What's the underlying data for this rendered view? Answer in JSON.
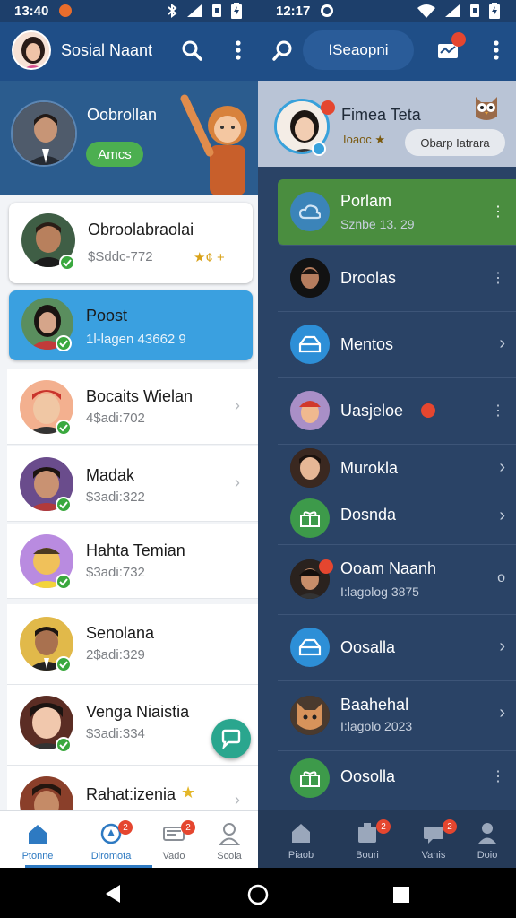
{
  "status_bar": {
    "left_time": "13:40",
    "right_time": "12:17"
  },
  "app_bar": {
    "title": "Sosial Naant",
    "search_pill": "ISeaopni"
  },
  "left_panel": {
    "profile": {
      "name": "Oobrollan",
      "chip": "Amcs"
    },
    "cards": [
      {
        "name": "Obroolabraolai",
        "sub": "$Sddc-772",
        "tag": "★¢ +"
      },
      {
        "name": "Poost",
        "sub": "1l-lagen 43662  9"
      }
    ],
    "rows": [
      {
        "name": "Bocaits Wielan",
        "sub": "4$adi:702"
      },
      {
        "name": "Madak",
        "sub": "$3adi:322"
      },
      {
        "name": "Hahta Temian",
        "sub": "$3adi:732"
      },
      {
        "name": "Senolana",
        "sub": "2$adi:329"
      },
      {
        "name": "Venga Niaistia",
        "sub": "$3adi:334"
      },
      {
        "name": "Rahat:izenia",
        "sub": ""
      }
    ]
  },
  "left_nav": [
    {
      "label": "Ptonne"
    },
    {
      "label": "Dlromota",
      "badge": "2"
    },
    {
      "label": "Vado",
      "badge": "2"
    },
    {
      "label": "Scola"
    }
  ],
  "right_panel": {
    "header": {
      "name": "Fimea Teta",
      "status": "Ioaoc ★",
      "pill": "Obarp Iatrara"
    },
    "items": [
      {
        "name": "Porlam",
        "sub": "Sznbe 13. 29",
        "trail": "⋮"
      },
      {
        "name": "Droolas",
        "sub": "",
        "trail": "⋮"
      },
      {
        "name": "Mentos",
        "sub": "",
        "trail": "›"
      },
      {
        "name": "Uasjeloe",
        "sub": "",
        "trail": "⋮"
      },
      {
        "name": "Murokla",
        "sub": "",
        "trail": "›"
      },
      {
        "name": "Dosnda",
        "sub": "",
        "trail": "›"
      },
      {
        "name": "Ooam Naanh",
        "sub": "I:lagolog 3875",
        "trail": "o"
      },
      {
        "name": "Oosalla",
        "sub": "",
        "trail": "›"
      },
      {
        "name": "Baahehal",
        "sub": "I:lagolo 2023",
        "trail": "›"
      },
      {
        "name": "Oosolla",
        "sub": "",
        "trail": "⋮"
      }
    ]
  },
  "right_nav": [
    {
      "label": "Piaob"
    },
    {
      "label": "Bouri",
      "badge": "2"
    },
    {
      "label": "Vanis",
      "badge": "2"
    },
    {
      "label": "Doio"
    }
  ],
  "colors": {
    "app_bar": "#1f4e87",
    "accent_green": "#4caf50",
    "accent_blue": "#3aa0e0",
    "right_bg": "#2a4366"
  }
}
